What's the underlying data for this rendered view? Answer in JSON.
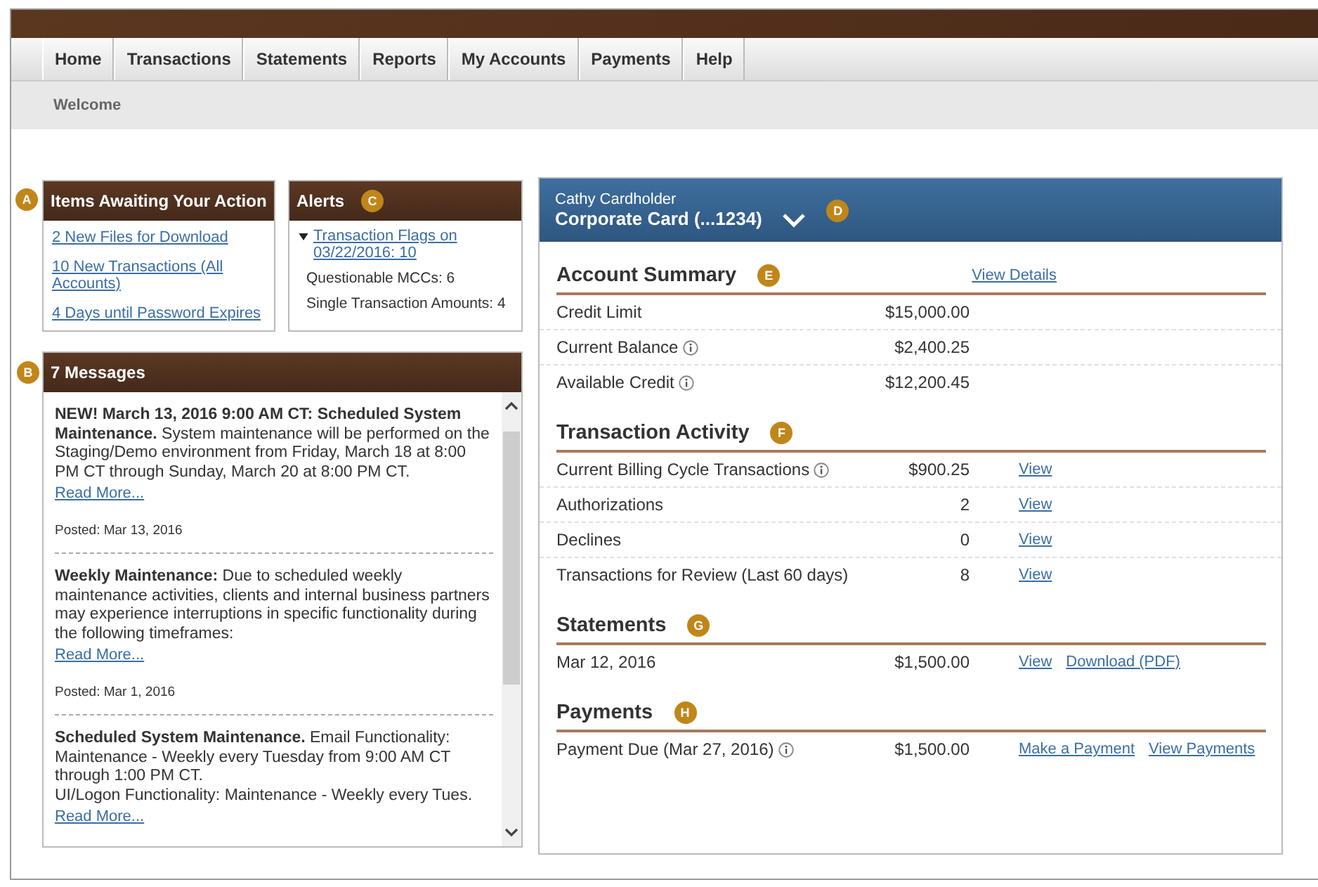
{
  "nav": {
    "tabs": [
      {
        "label": "Home"
      },
      {
        "label": "Transactions"
      },
      {
        "label": "Statements"
      },
      {
        "label": "Reports"
      },
      {
        "label": "My Accounts"
      },
      {
        "label": "Payments"
      },
      {
        "label": "Help"
      }
    ],
    "subnav": "Welcome"
  },
  "items_awaiting": {
    "callout": "A",
    "title": "Items Awaiting Your Action",
    "links": [
      "2 New Files for Download",
      "10 New Transactions (All Accounts)",
      "4 Days until Password Expires"
    ]
  },
  "alerts": {
    "callout": "C",
    "title": "Alerts",
    "flag_link": "Transaction Flags on 03/22/2016: 10",
    "expanded": true,
    "details": [
      "Questionable MCCs: 6",
      "Single Transaction Amounts: 4"
    ]
  },
  "messages": {
    "callout": "B",
    "title": "7 Messages",
    "items": [
      {
        "paragraphs": [
          "**NEW! March 13, 2016 9:00 AM CT: Scheduled System Maintenance.** System maintenance will be performed on the Staging/Demo environment from Friday, March 18 at 8:00 PM CT through Sunday, March 20 at 8:00 PM CT."
        ],
        "read_more": "Read More...",
        "posted": "Posted: Mar 13, 2016"
      },
      {
        "paragraphs": [
          "**Weekly Maintenance:** Due to scheduled weekly maintenance activities, clients and internal business partners may experience interruptions in specific functionality during the following timeframes:"
        ],
        "read_more": "Read More...",
        "posted": "Posted: Mar 1, 2016"
      },
      {
        "paragraphs": [
          "**Scheduled System Maintenance.**  Email Functionality: Maintenance - Weekly every Tuesday from 9:00 AM CT through 1:00 PM CT.",
          "UI/Logon Functionality: Maintenance - Weekly every Tues."
        ],
        "read_more": "Read More..."
      }
    ]
  },
  "account": {
    "callout": "D",
    "holder": "Cathy Cardholder",
    "card": "Corporate Card (...1234)",
    "sections": [
      {
        "callout": "E",
        "title": "Account Summary",
        "header_link": "View Details",
        "rows": [
          {
            "label": "Credit Limit",
            "info": false,
            "value": "$15,000.00",
            "links": []
          },
          {
            "label": "Current Balance",
            "info": true,
            "value": "$2,400.25",
            "links": []
          },
          {
            "label": "Available Credit",
            "info": true,
            "value": "$12,200.45",
            "links": []
          }
        ]
      },
      {
        "callout": "F",
        "title": "Transaction Activity",
        "rows": [
          {
            "label": "Current Billing Cycle Transactions",
            "info": true,
            "value": "$900.25",
            "links": [
              "View"
            ]
          },
          {
            "label": "Authorizations",
            "info": false,
            "value": "2",
            "links": [
              "View"
            ]
          },
          {
            "label": "Declines",
            "info": false,
            "value": "0",
            "links": [
              "View"
            ]
          },
          {
            "label": "Transactions for Review (Last 60 days)",
            "info": false,
            "value": "8",
            "links": [
              "View"
            ]
          }
        ]
      },
      {
        "callout": "G",
        "title": "Statements",
        "rows": [
          {
            "label": "Mar 12, 2016",
            "info": false,
            "value": "$1,500.00",
            "links": [
              "View",
              "Download (PDF)"
            ]
          }
        ]
      },
      {
        "callout": "H",
        "title": "Payments",
        "rows": [
          {
            "label": "Payment Due (Mar 27, 2016)",
            "info": true,
            "value": "$1,500.00",
            "links": [
              "Make a Payment",
              "View Payments"
            ]
          }
        ]
      }
    ]
  }
}
